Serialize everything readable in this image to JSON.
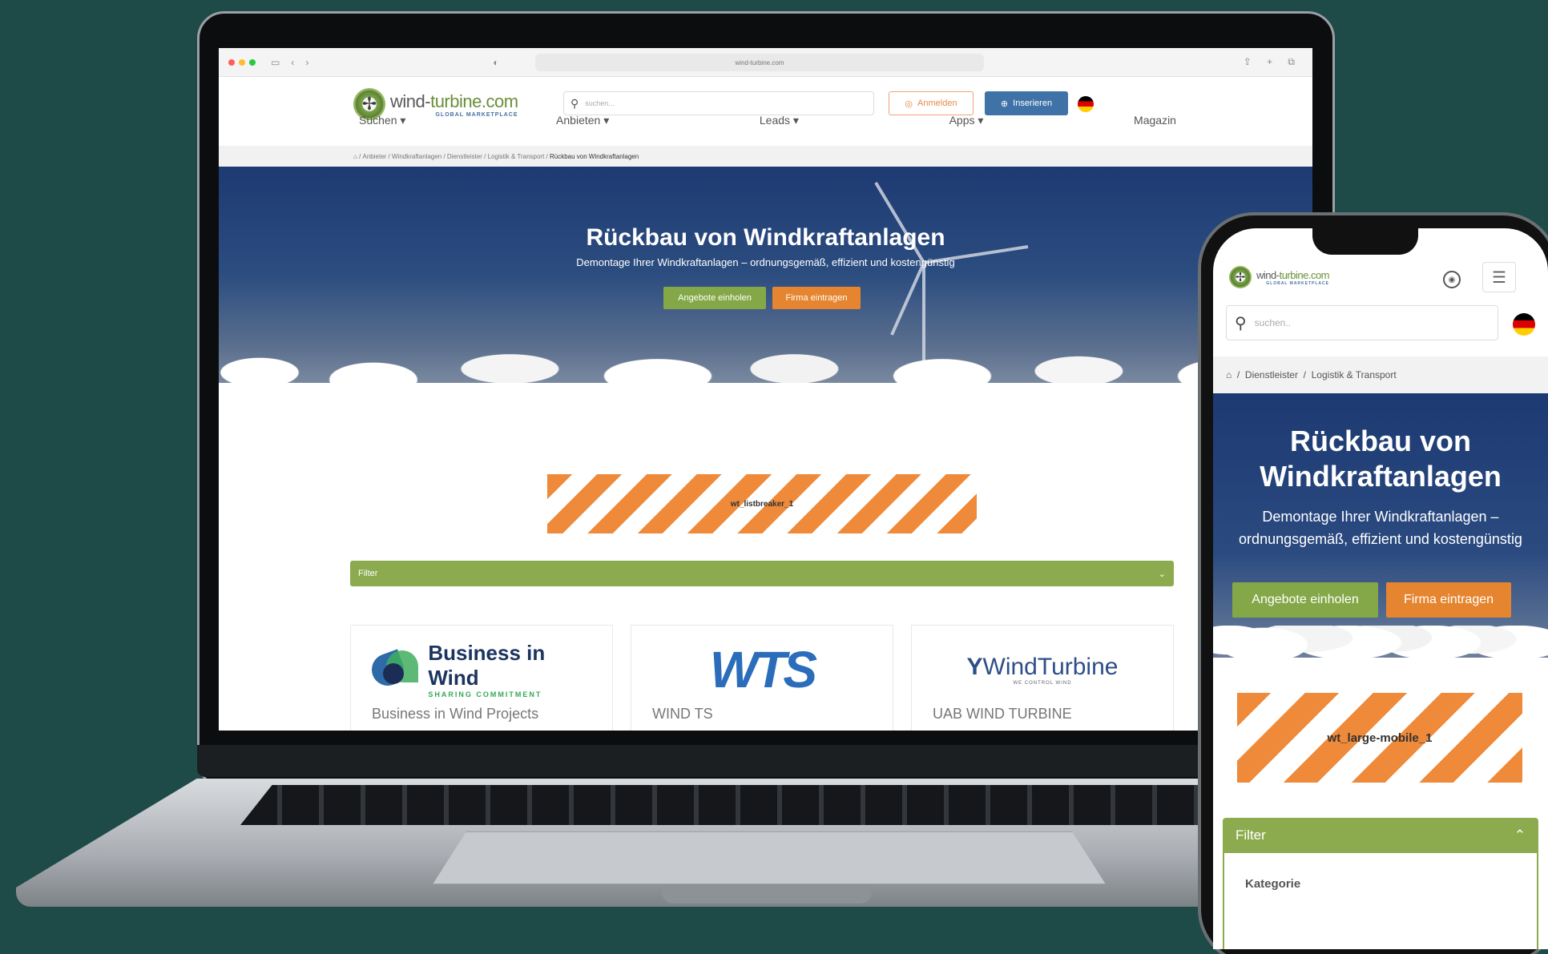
{
  "browser": {
    "url": "wind-turbine.com"
  },
  "site": {
    "logo_title_a": "wind-",
    "logo_title_b": "turbine.com",
    "logo_sub": "GLOBAL MARKETPLACE",
    "search_placeholder": "suchen...",
    "login_label": "Anmelden",
    "insert_label": "Inserieren",
    "nav": [
      "Suchen ▾",
      "Anbieten ▾",
      "Leads ▾",
      "Apps ▾",
      "Magazin"
    ],
    "breadcrumb": [
      "Anbieter",
      "Windkraftanlagen",
      "Dienstleister",
      "Logistik & Transport"
    ],
    "breadcrumb_active": "Rückbau von Windkraftanlagen"
  },
  "hero": {
    "title": "Rückbau von Windkraftanlagen",
    "subtitle": "Demontage Ihrer Windkraftanlagen – ordnungsgemäß, effizient und kostengünstig",
    "btn_offers": "Angebote einholen",
    "btn_company": "Firma eintragen"
  },
  "ad": {
    "desktop_label": "wt_listbreaker_1",
    "mobile_label": "wt_large-mobile_1"
  },
  "filter": {
    "label": "Filter",
    "mobile_first_section": "Kategorie"
  },
  "cards": [
    {
      "logo_line1": "Business in Wind",
      "logo_line2": "SHARING COMMITMENT",
      "name": "Business in Wind Projects"
    },
    {
      "logo_text": "WTS",
      "name": "WIND TS"
    },
    {
      "logo_text": "WindTurbine",
      "logo_sub": "WE CONTROL WIND",
      "name": "UAB WIND TURBINE"
    }
  ],
  "mobile": {
    "breadcrumb": [
      "Dienstleister",
      "Logistik & Transport"
    ],
    "search_placeholder": "suchen..",
    "hero_title_line1": "Rückbau von",
    "hero_title_line2": "Windkraftanlagen",
    "hero_sub": "Demontage Ihrer Windkraftanlagen – ordnungsgemäß, effizient und kostengünstig"
  },
  "colors": {
    "background": "#1e4a47",
    "brand_green": "#8cab4f",
    "brand_orange": "#e6852f",
    "brand_blue": "#3f73a8",
    "hero_blue": "#1d3a72"
  }
}
